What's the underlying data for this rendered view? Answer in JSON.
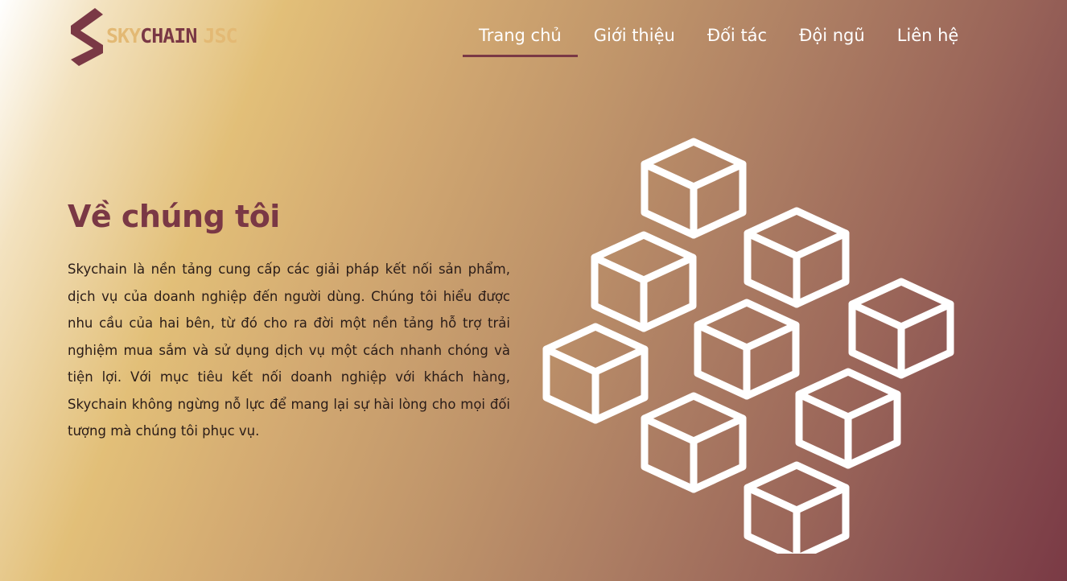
{
  "logo": {
    "part1": "SKY",
    "part2": "CHAIN",
    "part3": "JSC",
    "colors": {
      "gold": "#e3b974",
      "maroon": "#7a3845"
    }
  },
  "nav": {
    "items": [
      {
        "label": "Trang chủ",
        "active": true
      },
      {
        "label": "Giới thiệu",
        "active": false
      },
      {
        "label": "Đối tác",
        "active": false
      },
      {
        "label": "Đội ngũ",
        "active": false
      },
      {
        "label": "Liên hệ",
        "active": false
      }
    ]
  },
  "about": {
    "title": "Về chúng tôi",
    "description": "Skychain là nền tảng cung cấp các giải pháp kết nối sản phẩm, dịch vụ của doanh nghiệp đến người dùng. Chúng tôi hiểu được nhu cầu của hai bên, từ đó cho ra đời một nền tảng hỗ trợ trải nghiệm mua sắm và sử dụng dịch vụ một cách nhanh chóng và tiện lợi. Với mục tiêu kết nối doanh nghiệp với khách hàng, Skychain không ngừng nỗ lực để mang lại sự hài lòng cho mọi đối tượng mà chúng tôi phục vụ."
  },
  "illustration": {
    "icon": "isometric-cubes-illustration",
    "color": "#ffffff"
  },
  "theme": {
    "accent": "#7a3845",
    "gold": "#e3b974"
  }
}
